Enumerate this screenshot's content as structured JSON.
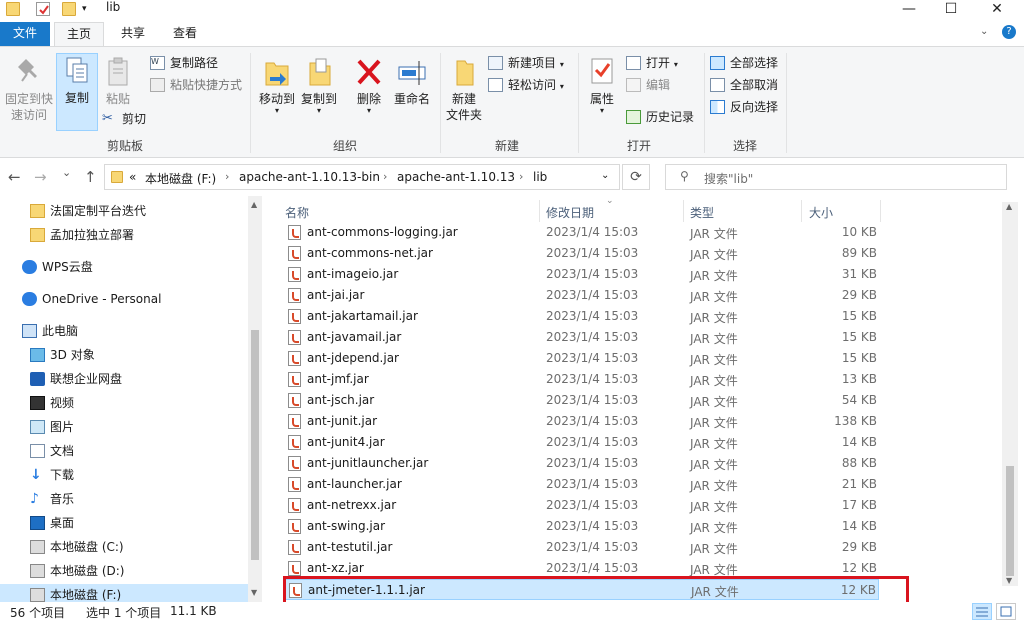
{
  "window": {
    "title": "lib",
    "minimize_glyph": "—",
    "maximize_glyph": "☐",
    "close_glyph": "✕"
  },
  "tabs": [
    {
      "label": "文件"
    },
    {
      "label": "主页"
    },
    {
      "label": "共享"
    },
    {
      "label": "查看"
    }
  ],
  "ribbon": {
    "clipboard": {
      "label": "剪贴板",
      "pin_line1": "固定到快",
      "pin_line2": "速访问",
      "copy": "复制",
      "paste": "粘贴",
      "copy_path": "复制路径",
      "paste_shortcut": "粘贴快捷方式",
      "cut": "剪切"
    },
    "organize": {
      "label": "组织",
      "move_to": "移动到",
      "copy_to": "复制到",
      "delete": "删除",
      "rename": "重命名"
    },
    "new": {
      "label": "新建",
      "new_folder_line1": "新建",
      "new_folder_line2": "文件夹",
      "new_item": "新建项目",
      "easy_access": "轻松访问"
    },
    "open": {
      "label": "打开",
      "properties": "属性",
      "open": "打开",
      "edit": "编辑",
      "history": "历史记录"
    },
    "select": {
      "label": "选择",
      "select_all": "全部选择",
      "select_none": "全部取消",
      "invert": "反向选择"
    }
  },
  "address": {
    "back_glyph": "←",
    "forward_glyph": "→",
    "recent_glyph": "⌄",
    "up_glyph": "↑",
    "overflow": "«",
    "crumbs": [
      "本地磁盘 (F:)",
      "apache-ant-1.10.13-bin",
      "apache-ant-1.10.13",
      "lib"
    ],
    "crumb_sep": "›",
    "refresh_glyph": "⟳",
    "search_placeholder": "搜索\"lib\""
  },
  "nav": {
    "items": [
      {
        "label": "法国定制平台迭代",
        "icon": "folder-icon"
      },
      {
        "label": "孟加拉独立部署",
        "icon": "folder-icon"
      },
      {
        "label": "WPS云盘",
        "icon": "cloud-icon"
      },
      {
        "label": "OneDrive - Personal",
        "icon": "cloud-icon"
      },
      {
        "label": "此电脑",
        "icon": "computer-icon"
      },
      {
        "label": "3D 对象",
        "icon": "cube-icon"
      },
      {
        "label": "联想企业网盘",
        "icon": "drive-icon"
      },
      {
        "label": "视频",
        "icon": "video-icon"
      },
      {
        "label": "图片",
        "icon": "picture-icon"
      },
      {
        "label": "文档",
        "icon": "document-icon"
      },
      {
        "label": "下载",
        "icon": "download-icon"
      },
      {
        "label": "音乐",
        "icon": "music-icon"
      },
      {
        "label": "桌面",
        "icon": "desktop-icon"
      },
      {
        "label": "本地磁盘 (C:)",
        "icon": "disk-icon"
      },
      {
        "label": "本地磁盘 (D:)",
        "icon": "disk-icon"
      },
      {
        "label": "本地磁盘 (F:)",
        "icon": "disk-icon"
      }
    ]
  },
  "columns": {
    "name": "名称",
    "date": "修改日期",
    "type": "类型",
    "size": "大小"
  },
  "files": [
    {
      "name": "ant-commons-logging.jar",
      "date": "2023/1/4 15:03",
      "type": "JAR 文件",
      "size": "10 KB"
    },
    {
      "name": "ant-commons-net.jar",
      "date": "2023/1/4 15:03",
      "type": "JAR 文件",
      "size": "89 KB"
    },
    {
      "name": "ant-imageio.jar",
      "date": "2023/1/4 15:03",
      "type": "JAR 文件",
      "size": "31 KB"
    },
    {
      "name": "ant-jai.jar",
      "date": "2023/1/4 15:03",
      "type": "JAR 文件",
      "size": "29 KB"
    },
    {
      "name": "ant-jakartamail.jar",
      "date": "2023/1/4 15:03",
      "type": "JAR 文件",
      "size": "15 KB"
    },
    {
      "name": "ant-javamail.jar",
      "date": "2023/1/4 15:03",
      "type": "JAR 文件",
      "size": "15 KB"
    },
    {
      "name": "ant-jdepend.jar",
      "date": "2023/1/4 15:03",
      "type": "JAR 文件",
      "size": "15 KB"
    },
    {
      "name": "ant-jmf.jar",
      "date": "2023/1/4 15:03",
      "type": "JAR 文件",
      "size": "13 KB"
    },
    {
      "name": "ant-jsch.jar",
      "date": "2023/1/4 15:03",
      "type": "JAR 文件",
      "size": "54 KB"
    },
    {
      "name": "ant-junit.jar",
      "date": "2023/1/4 15:03",
      "type": "JAR 文件",
      "size": "138 KB"
    },
    {
      "name": "ant-junit4.jar",
      "date": "2023/1/4 15:03",
      "type": "JAR 文件",
      "size": "14 KB"
    },
    {
      "name": "ant-junitlauncher.jar",
      "date": "2023/1/4 15:03",
      "type": "JAR 文件",
      "size": "88 KB"
    },
    {
      "name": "ant-launcher.jar",
      "date": "2023/1/4 15:03",
      "type": "JAR 文件",
      "size": "21 KB"
    },
    {
      "name": "ant-netrexx.jar",
      "date": "2023/1/4 15:03",
      "type": "JAR 文件",
      "size": "17 KB"
    },
    {
      "name": "ant-swing.jar",
      "date": "2023/1/4 15:03",
      "type": "JAR 文件",
      "size": "14 KB"
    },
    {
      "name": "ant-testutil.jar",
      "date": "2023/1/4 15:03",
      "type": "JAR 文件",
      "size": "29 KB"
    },
    {
      "name": "ant-xz.jar",
      "date": "2023/1/4 15:03",
      "type": "JAR 文件",
      "size": "12 KB"
    },
    {
      "name": "ant-jmeter-1.1.1.jar",
      "date": "",
      "type": "JAR 文件",
      "size": "12 KB",
      "selected": true
    }
  ],
  "status": {
    "count": "56 个项目",
    "selected": "选中 1 个项目",
    "size": "11.1 KB"
  },
  "colors": {
    "file_tab": "#1979ca",
    "selection": "#cce8ff",
    "highlight_border": "#d9141e"
  }
}
